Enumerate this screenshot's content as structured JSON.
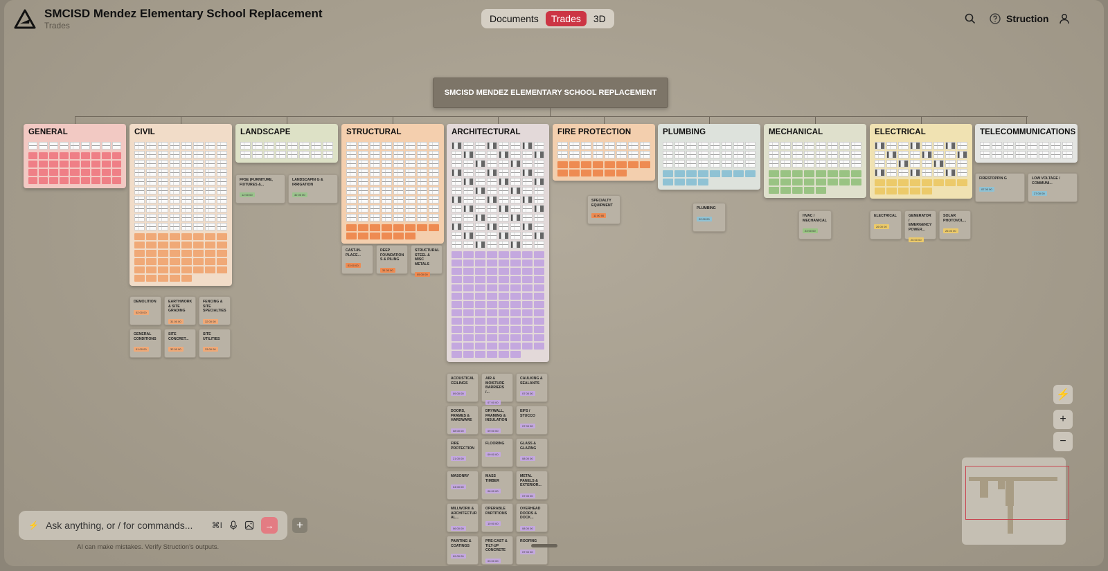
{
  "header": {
    "title": "SMCISD Mendez Elementary School Replacement",
    "subtitle": "Trades",
    "brand": "Struction",
    "tabs": [
      {
        "label": "Documents"
      },
      {
        "label": "Trades",
        "active": true
      },
      {
        "label": "3D"
      }
    ]
  },
  "board": {
    "root_title": "SMCISD MENDEZ ELEMENTARY SCHOOL REPLACEMENT",
    "trades": [
      {
        "name": "GENERAL",
        "color": "#f2c9c3",
        "tag_color": "#ef7f86",
        "subs": []
      },
      {
        "name": "CIVIL",
        "color": "#f1dcc8",
        "tag_color": "#f0a977",
        "subs": [
          {
            "name": "DEMOLITION",
            "count": "02 00 00"
          },
          {
            "name": "EARTHWORK & SITE GRADING",
            "count": "31 00 00"
          },
          {
            "name": "FENCING & SITE SPECIALTIES",
            "count": "32 00 00"
          },
          {
            "name": "GENERAL CONDITIONS",
            "count": "01 00 00"
          },
          {
            "name": "SITE CONCRET...",
            "count": "32 00 00"
          },
          {
            "name": "SITE UTILITIES",
            "count": "33 00 00"
          }
        ]
      },
      {
        "name": "LANDSCAPE",
        "color": "#dde1c6",
        "tag_color": "#9bc38d",
        "subs": [
          {
            "name": "FFSE (FURNITURE, FIXTURES &...",
            "count": "12 00 00"
          },
          {
            "name": "LANDSCAPIN G & IRRIGATION",
            "count": "32 00 00"
          }
        ]
      },
      {
        "name": "STRUCTURAL",
        "color": "#f4cfae",
        "tag_color": "#ee8b52",
        "subs": [
          {
            "name": "CAST-IN-PLACE...",
            "count": "03 00 00"
          },
          {
            "name": "DEEP FOUNDATION S & PILING",
            "count": "31 00 00"
          },
          {
            "name": "STRUCTURAL STEEL & MISC METALS",
            "count": "05 00 00"
          }
        ]
      },
      {
        "name": "ARCHITECTURAL",
        "color": "#e3d9d9",
        "tag_color": "#c4a8df",
        "subs": [
          {
            "name": "ACOUSTICAL CEILINGS",
            "count": "09 00 00"
          },
          {
            "name": "AIR & MOISTURE BARRIERS /...",
            "count": "07 00 00"
          },
          {
            "name": "CAULKING & SEALANTS",
            "count": "07 00 00"
          },
          {
            "name": "DOORS, FRAMES & HARDWARE",
            "count": "08 00 00"
          },
          {
            "name": "DRYWALL, FRAMING & INSULATION",
            "count": "09 00 00"
          },
          {
            "name": "EIFS / STUCCO",
            "count": "07 00 00"
          },
          {
            "name": "FIRE PROTECTION",
            "count": "21 00 00"
          },
          {
            "name": "FLOORING",
            "count": "09 00 00"
          },
          {
            "name": "GLASS & GLAZING",
            "count": "08 00 00"
          },
          {
            "name": "MASONRY",
            "count": "04 00 00"
          },
          {
            "name": "MASS TIMBER",
            "count": "06 00 00"
          },
          {
            "name": "METAL PANELS & EXTERIOR...",
            "count": "07 00 00"
          },
          {
            "name": "MILLWORK & ARCHITECTUR AL...",
            "count": "06 00 00"
          },
          {
            "name": "OPERABLE PARTITIONS",
            "count": "10 00 00"
          },
          {
            "name": "OVERHEAD DOORS & DOCK...",
            "count": "08 00 00"
          },
          {
            "name": "PAINTING & COATINGS",
            "count": "09 00 00"
          },
          {
            "name": "PRE-CAST & TILT-UP CONCRETE",
            "count": "03 00 00"
          },
          {
            "name": "ROOFING",
            "count": "07 00 00"
          }
        ]
      },
      {
        "name": "FIRE PROTECTION",
        "color": "#f3cfae",
        "tag_color": "#ee8b52",
        "subs": [
          {
            "name": "SPECIALTY EQUIPMENT",
            "count": "11 00 00"
          }
        ]
      },
      {
        "name": "PLUMBING",
        "color": "#dde2dc",
        "tag_color": "#8fc2d4",
        "subs": [
          {
            "name": "PLUMBING",
            "count": "22 00 00"
          }
        ]
      },
      {
        "name": "MECHANICAL",
        "color": "#dfe0cc",
        "tag_color": "#99c383",
        "subs": [
          {
            "name": "HVAC / MECHANICAL",
            "count": "23 00 00"
          }
        ]
      },
      {
        "name": "ELECTRICAL",
        "color": "#f0e2b2",
        "tag_color": "#ecca6a",
        "subs": [
          {
            "name": "ELECTRICAL",
            "count": "26 00 00"
          },
          {
            "name": "GENERATOR / EMERGENCY POWER...",
            "count": "26 00 00"
          },
          {
            "name": "SOLAR PHOTOVOL...",
            "count": "26 00 00"
          }
        ]
      },
      {
        "name": "TELECOMMUNICATIONS",
        "color": "#e3e4e1",
        "tag_color": "#8fc2d4",
        "subs": [
          {
            "name": "FIRESTOPPIN G",
            "count": "07 00 00"
          },
          {
            "name": "LOW VOLTAGE / COMMUNI...",
            "count": "27 00 00"
          }
        ]
      }
    ]
  },
  "chat": {
    "placeholder": "Ask anything, or / for commands...",
    "shortcut": "⌘I",
    "disclaimer": "AI can make mistakes. Verify Struction's outputs."
  },
  "controls": {
    "zoom_in": "+",
    "zoom_out": "−"
  }
}
